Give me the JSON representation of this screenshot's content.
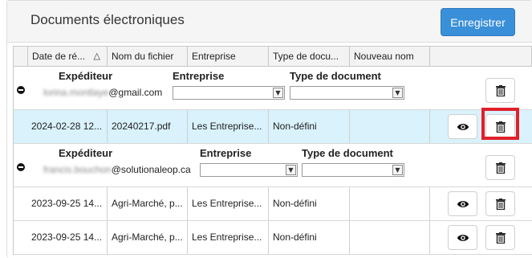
{
  "panel": {
    "title": "Documents électroniques",
    "save_label": "Enregistrer"
  },
  "columns": [
    "Date de ré...",
    "Nom du fichier",
    "Entreprise",
    "Type de docu...",
    "Nouveau nom"
  ],
  "groups": [
    {
      "sender_label": "Expéditeur",
      "company_label": "Entreprise",
      "doctype_label": "Type de document",
      "email_blurred": "lorina.montlaye",
      "email_domain": "@gmail.com",
      "company_value": "",
      "doctype_value": "",
      "rows": [
        {
          "date": "2024-02-28 12...",
          "file": "20240217.pdf",
          "company": "Les Entreprise...",
          "doctype": "Non-défini",
          "new_name": "",
          "selected": true
        }
      ]
    },
    {
      "sender_label": "Expéditeur",
      "company_label": "Entreprise",
      "doctype_label": "Type de document",
      "email_blurred": "francis.bouchon",
      "email_domain": "@solutionaleop.ca",
      "company_value": "",
      "doctype_value": "",
      "rows": [
        {
          "date": "2023-09-25 14...",
          "file": "Agri-Marché, p...",
          "company": "Les Entreprise...",
          "doctype": "Non-défini",
          "new_name": "",
          "selected": false
        },
        {
          "date": "2023-09-25 14...",
          "file": "Agri-Marché, p...",
          "company": "Les Entreprise...",
          "doctype": "Non-défini",
          "new_name": "",
          "selected": false
        }
      ]
    }
  ],
  "icons": {
    "view": "eye-icon",
    "delete": "trash-icon",
    "collapse": "minus-circle-icon",
    "sort": "triangle-up-icon"
  },
  "colors": {
    "primary": "#3a8fd9",
    "selected_row": "#d9f2fb",
    "highlight": "#e0202a"
  }
}
